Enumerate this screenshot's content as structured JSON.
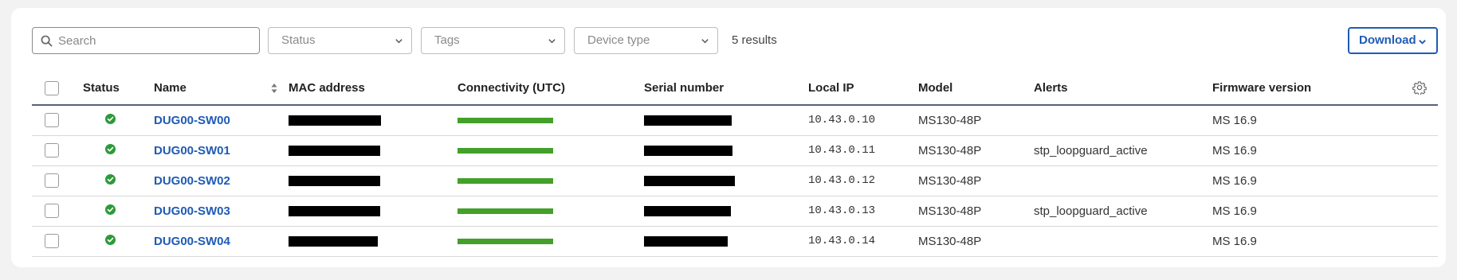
{
  "toolbar": {
    "search_placeholder": "Search",
    "filters": [
      {
        "label": "Status"
      },
      {
        "label": "Tags"
      },
      {
        "label": "Device type"
      }
    ],
    "results_text": "5 results",
    "download_label": "Download"
  },
  "table": {
    "columns": {
      "status": "Status",
      "name": "Name",
      "mac": "MAC address",
      "connectivity": "Connectivity (UTC)",
      "serial": "Serial number",
      "local_ip": "Local IP",
      "model": "Model",
      "alerts": "Alerts",
      "firmware": "Firmware version"
    },
    "rows": [
      {
        "status": "online",
        "name": "DUG00-SW00",
        "local_ip": "10.43.0.10",
        "model": "MS130-48P",
        "alerts": "",
        "firmware": "MS 16.9"
      },
      {
        "status": "online",
        "name": "DUG00-SW01",
        "local_ip": "10.43.0.11",
        "model": "MS130-48P",
        "alerts": "stp_loopguard_active",
        "firmware": "MS 16.9"
      },
      {
        "status": "online",
        "name": "DUG00-SW02",
        "local_ip": "10.43.0.12",
        "model": "MS130-48P",
        "alerts": "",
        "firmware": "MS 16.9"
      },
      {
        "status": "online",
        "name": "DUG00-SW03",
        "local_ip": "10.43.0.13",
        "model": "MS130-48P",
        "alerts": "stp_loopguard_active",
        "firmware": "MS 16.9"
      },
      {
        "status": "online",
        "name": "DUG00-SW04",
        "local_ip": "10.43.0.14",
        "model": "MS130-48P",
        "alerts": "",
        "firmware": "MS 16.9"
      }
    ]
  },
  "icons": {
    "search": "search-icon",
    "chevron": "chevron-down-icon",
    "sort": "sort-icon",
    "settings": "gear-icon",
    "status_online": "check-circle-icon"
  },
  "colors": {
    "link": "#1f5bb5",
    "online": "#2e9a3a",
    "connectivity": "#44a02a",
    "header_rule": "#5a5f7a"
  }
}
